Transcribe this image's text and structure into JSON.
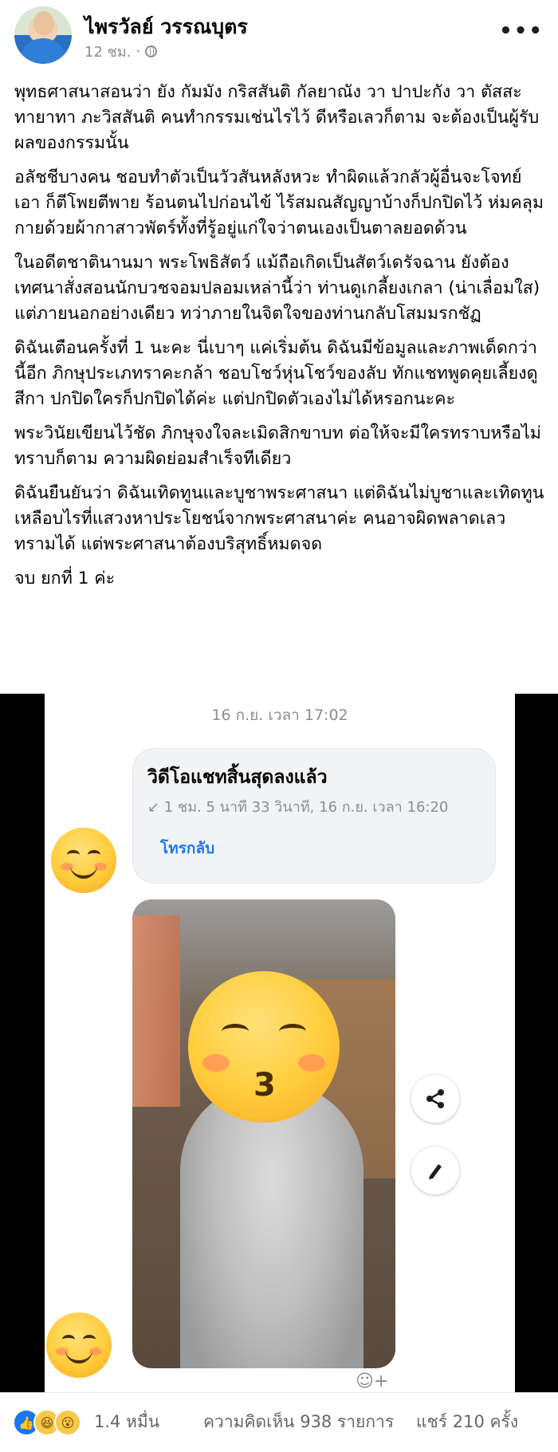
{
  "post": {
    "author": "ไพรวัลย์ วรรณบุตร",
    "time": "12 ชม.",
    "more": "•••",
    "paragraphs": [
      "พุทธศาสนาสอนว่า ยัง กัมมัง กริสสันติ กัลยาณัง วา ปาปะกัง วา ตัสสะ ทายาทา ภะวิสสันติ คนทำกรรมเช่นไรไว้ ดีหรือเลวก็ตาม จะต้องเป็นผู้รับผลของกรรมนั้น",
      "อลัชชีบางคน ชอบทำตัวเป็นวัวสันหลังหวะ ทำผิดแล้วกลัวผู้อื่นจะโจทย์เอา ก็ตีโพยตีพาย ร้อนตนไปก่อนไข้ ไร้สมณสัญญาบ้างก็ปกปิดไว้ ห่มคลุมกายด้วยผ้ากาสาวพัตร์ทั้งที่รู้อยู่แก่ใจว่าตนเองเป็นตาลยอดด้วน",
      "ในอดีตชาตินานมา พระโพธิสัตว์ แม้ถือเกิดเป็นสัตว์เดรัจฉาน ยังต้องเทศนาสั่งสอนนักบวชจอมปลอมเหล่านี้ว่า ท่านดูเกลี้ยงเกลา (น่าเลื่อมใส) แต่ภายนอกอย่างเดียว ทว่าภายในจิตใจของท่านกลับโสมมรกชัฏ",
      "ดิฉันเตือนครั้งที่ 1 นะคะ นี่เบาๆ แค่เริ่มต้น ดิฉันมีข้อมูลและภาพเด็ดกว่านี้อีก ภิกษุประเภทราคะกล้า ชอบโชว์หุ่นโชว์ของลับ ทักแชทพูดคุยเลี้ยงดูสีกา ปกปิดใครก็ปกปิดได้ค่ะ แต่ปกปิดตัวเองไม่ได้หรอกนะคะ",
      "พระวินัยเขียนไว้ชัด ภิกษุจงใจละเมิดสิกขาบท ต่อให้จะมีใครทราบหรือไม่ทราบก็ตาม ความผิดย่อมสำเร็จทีเดียว",
      "ดิฉันยืนยันว่า ดิฉันเทิดทูนและบูชาพระศาสนา แต่ดิฉันไม่บูชาและเทิดทูนเหลือบไรที่แสวงหาประโยชน์จากพระศาสนาค่ะ คนอาจผิดพลาดเลวทรามได้ แต่พระศาสนาต้องบริสุทธิ์หมดจด",
      "จบ ยกที่ 1 ค่ะ"
    ]
  },
  "screenshot": {
    "timestamp": "16 ก.ย. เวลา 17:02",
    "call_title": "วิดีโอแชทสิ้นสุดลงแล้ว",
    "call_detail": "↙ 1 ชม. 5 นาที 33 วินาที, 16 ก.ย. เวลา 16:20",
    "call_back": "โทรกลับ"
  },
  "footer": {
    "reaction_count": "1.4 หมื่น",
    "comments": "ความคิดเห็น 938 รายการ",
    "shares": "แชร์ 210 ครั้ง"
  },
  "icons": [
    "globe-icon",
    "more-icon",
    "share-icon",
    "edit-icon",
    "like-icon",
    "haha-icon",
    "wow-icon",
    "smile-emoji-icon",
    "kiss-emoji-icon",
    "add-reaction-icon"
  ],
  "colors": {
    "link": "#1877f2",
    "muted": "#65676b",
    "meta": "#8a8d91"
  }
}
